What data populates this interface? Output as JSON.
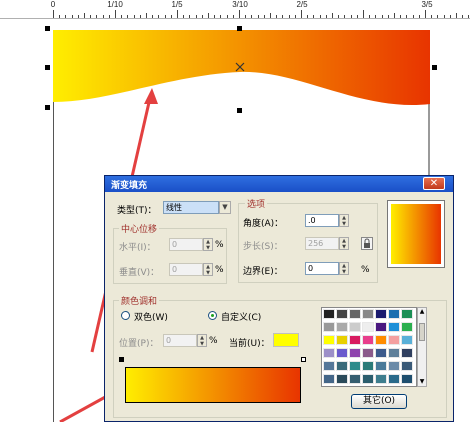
{
  "ruler": {
    "labels": [
      "0",
      "1/10",
      "1/5",
      "3/10",
      "2/5",
      "3/5"
    ]
  },
  "dialog": {
    "title": "渐变填充",
    "close_glyph": "✕",
    "type_label": "类型(T)：",
    "type_value": "线性",
    "center_offset_label": "中心位移",
    "horizontal_label": "水平(I)：",
    "horizontal_value": "0",
    "vertical_label": "垂直(V)：",
    "vertical_value": "0",
    "percent": "%",
    "options_label": "选项",
    "angle_label": "角度(A)：",
    "angle_value": ".0",
    "steps_label": "步长(S)：",
    "steps_value": "256",
    "edge_label": "边界(E)：",
    "edge_value": "0",
    "color_blend_label": "颜色调和",
    "two_color_label": "双色(W)",
    "custom_label": "自定义(C)",
    "position_label": "位置(P)：",
    "position_value": "0",
    "current_label": "当前(U)：",
    "others_button": "其它(O)"
  },
  "colors": {
    "gradient_start": "#ffee00",
    "gradient_end": "#e83400",
    "current_color": "#ffff00",
    "palette": [
      "#222222",
      "#444444",
      "#666666",
      "#888888",
      "#1a1a6e",
      "#1b6fb0",
      "#1c8f56",
      "#999999",
      "#aaaaaa",
      "#cccccc",
      "#eeeeee",
      "#4a1880",
      "#1e90d8",
      "#2cb050",
      "#ffff00",
      "#e8d000",
      "#d81b60",
      "#e83e8c",
      "#ff8c00",
      "#f4a0a0",
      "#59b0d8",
      "#9c8fc8",
      "#6a5acd",
      "#8e44ad",
      "#8b5a8b",
      "#3c5a8c",
      "#5e7f9a",
      "#304060",
      "#557799",
      "#3a6a7a",
      "#2e8b8b",
      "#2b7a78",
      "#4a7a9a",
      "#6a8aa8",
      "#3a5a78",
      "#446688",
      "#2a4a5a",
      "#355e70",
      "#2c5e6e",
      "#3e7e8e",
      "#2a6a8a",
      "#1f4f6f"
    ]
  }
}
